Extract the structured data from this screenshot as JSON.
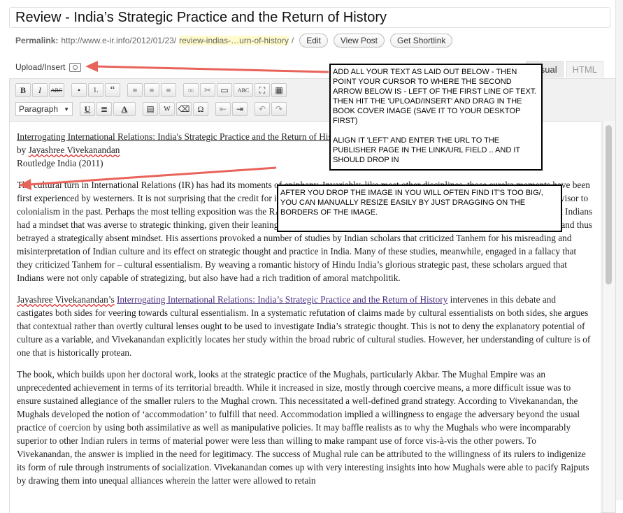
{
  "post": {
    "title": "Review - India’s Strategic Practice and the Return of History"
  },
  "permalink": {
    "label": "Permalink:",
    "base": "http://www.e-ir.info/2012/01/23/",
    "slug": "review-indias-…urn-of-history",
    "suffix": "/",
    "edit_label": "Edit",
    "view_label": "View Post",
    "shortlink_label": "Get Shortlink"
  },
  "upload": {
    "label": "Upload/Insert",
    "icon": "camera-media-icon"
  },
  "editor_tabs": {
    "visual": "Visual",
    "html": "HTML"
  },
  "toolbar": {
    "row1": [
      "B",
      "I",
      "ABC",
      "•",
      "1.",
      "“",
      "≡",
      "≡",
      "≡",
      "∞",
      "✂",
      "▭",
      "ABC",
      "⛶",
      "▦"
    ],
    "format_select": "Paragraph",
    "row2": [
      "U",
      "≣",
      "A",
      "▤",
      "W",
      "⌫",
      "Ω",
      "⇤",
      "⇥",
      "↶",
      "↷"
    ]
  },
  "content": {
    "header_line1": "Interrogating International Relations: India's Strategic Practice and the Return of History",
    "header_line2_prefix": "by ",
    "header_author": "Jayashree Vivekanandan",
    "header_line3": "Routledge India (2011)",
    "p1": "The cultural turn in International Relations (IR) has had its moments of epiphany. Invariably, like most other disciplines, those eureka moments have been first experienced by westerners. It is not surprising that the credit for inaugurating a cultural approach is often credited with being the scientific advisor to colonialism in the past. Perhaps the most telling exposition was the RAND study of 1992, in which American scholar George Tanhem claimed that Indians had a mindset that was averse to strategic thinking, given their leanings towards karmic philosophy and circular logic, were incapable of planning and thus betrayed a strategically absent mindset. His assertions provoked a number of studies by Indian scholars that criticized Tanhem for his misreading and misinterpretation of Indian culture and its effect on strategic thought and practice in India. Many of these studies, meanwhile, engaged in a fallacy that they criticized Tanhem for – cultural essentialism. By weaving a romantic history of Hindu India’s glorious strategic past, these scholars argued that Indians were not only capable of strategizing, but also have had a rich tradition of amoral matchpolitik.",
    "p2_author": "Jayashree Vivekanandan’s",
    "p2_link": "Interrogating International Relations: India’s Strategic Practice and the Return of History",
    "p2_rest": " intervenes in this debate and castigates both sides for veering towards cultural essentialism. In a systematic refutation of claims made by cultural essentialists on both sides, she argues that contextual rather than overtly cultural lenses ought to be used to investigate India’s strategic thought. This is not to deny the explanatory potential of culture as a variable, and Vivekanandan explicitly locates her study within the broad rubric of cultural studies. However, her understanding of culture is of one that is historically protean.",
    "p3": "The book, which builds upon her doctoral work, looks at the strategic practice of the Mughals, particularly Akbar. The Mughal Empire was an unprecedented achievement in terms of its territorial breadth. While it increased in size, mostly through coercive means, a more difficult issue was to ensure sustained allegiance of the smaller rulers to the Mughal crown. This necessitated a well-defined grand strategy. According to Vivekanandan, the Mughals developed the notion of ‘accommodation’ to fulfill that need.  Accommodation implied a willingness to engage the adversary beyond the usual practice of coercion by using both assimilative as well as manipulative policies. It may baffle realists as to why the Mughals who were incomparably superior to other Indian rulers in terms of material power were less than willing to make rampant use of force vis-à-vis the other powers. To Vivekanandan, the answer is implied in the need for legitimacy. The success of Mughal rule can be attributed to the willingness of its rulers to indigenize its form of rule through instruments of socialization. Vivekanandan comes up with very interesting insights into how Mughals were able to pacify Rajputs by drawing them into unequal alliances wherein the latter were allowed to retain"
  },
  "notes": {
    "note1": "ADD ALL YOUR TEXT AS LAID OUT BELOW - THEN POINT YOUR CURSOR TO WHERE THE SECOND ARROW BELOW IS - LEFT OF THE FIRST LINE OF TEXT. THEN HIT THE 'UPLOAD/INSERT' AND DRAG IN THE BOOK COVER IMAGE (SAVE IT TO YOUR DESKTOP FIRST)\n\nALIGN IT 'LEFT'  AND ENTER THE URL TO THE PUBLISHER PAGE IN THE LINK/URL FIELD .. AND IT SHOULD DROP IN",
    "note2": "AFTER YOU DROP THE IMAGE IN YOU WILL OFTEN FIND IT'S TOO BIG/, YOU CAN MANUALLY RESIZE EASILY BY JUST DRAGGING ON THE BORDERS OF THE IMAGE."
  },
  "colors": {
    "arrow": "#e8645a",
    "link": "#4a2f7f",
    "highlight": "#fffbcc"
  }
}
